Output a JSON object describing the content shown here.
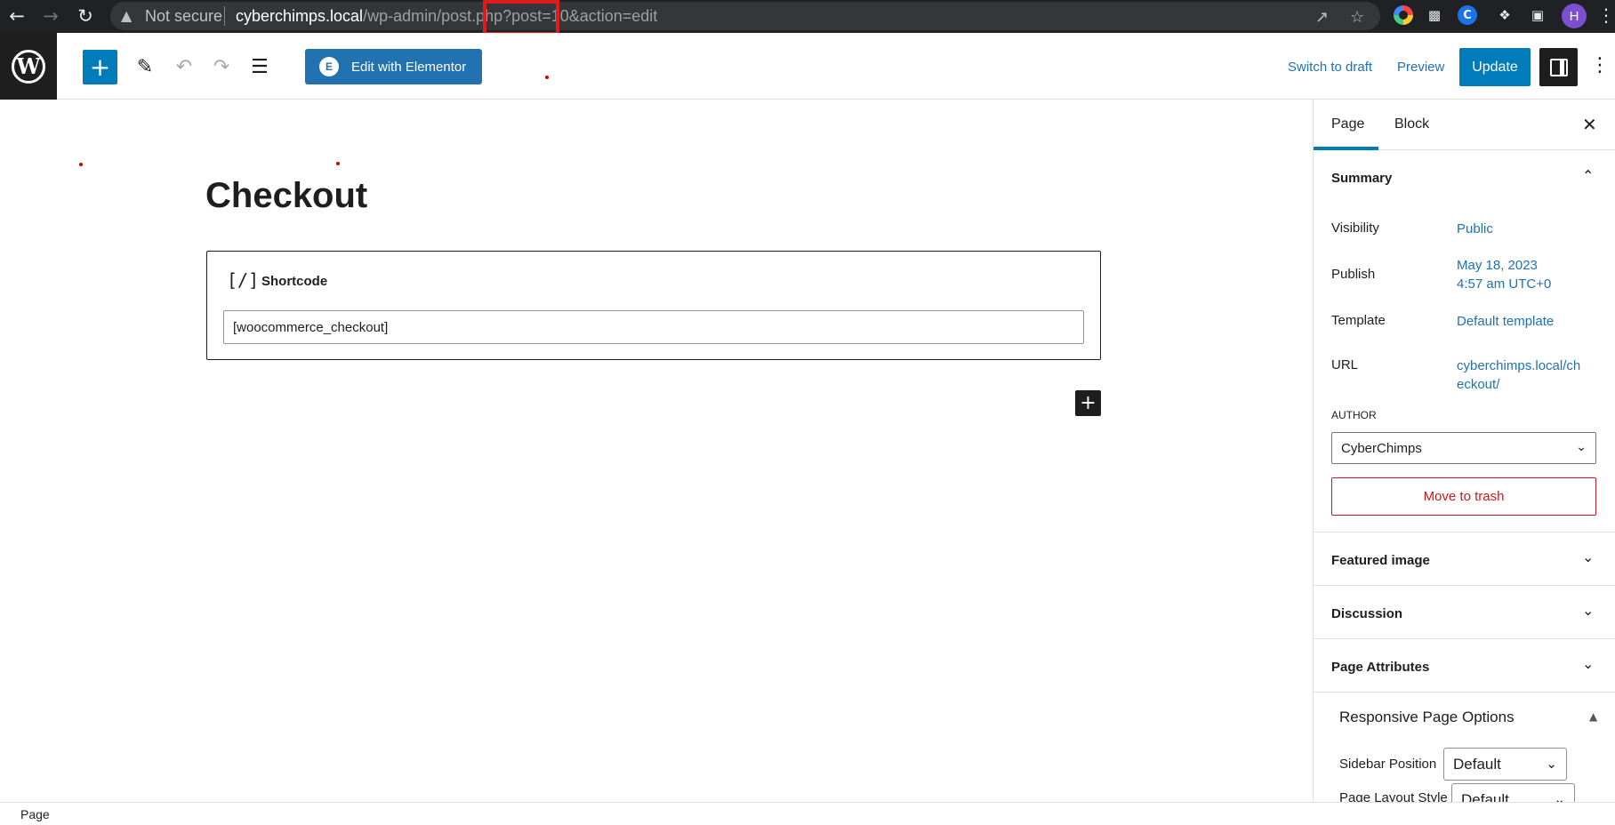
{
  "browser": {
    "security_label": "Not secure",
    "url_host": "cyberchimps.local",
    "url_path": "/wp-admin/post.php",
    "url_query": "?post=10&action=edit",
    "avatar_letter": "H"
  },
  "toolbar": {
    "elementor_label": "Edit with Elementor",
    "switch_to_draft_label": "Switch to draft",
    "preview_label": "Preview",
    "update_label": "Update"
  },
  "editor": {
    "title": "Checkout",
    "block": {
      "icon_text": "[/]",
      "label": "Shortcode",
      "value": "[woocommerce_checkout]"
    }
  },
  "sidebar": {
    "tabs": [
      {
        "label": "Page",
        "active": true
      },
      {
        "label": "Block",
        "active": false
      }
    ],
    "summary": {
      "title": "Summary",
      "rows": [
        {
          "label": "Visibility",
          "value": "Public"
        },
        {
          "label": "Publish",
          "value_line1": "May 18, 2023",
          "value_line2": "4:57 am UTC+0"
        },
        {
          "label": "Template",
          "value": "Default template"
        },
        {
          "label": "URL",
          "value_line1": "cyberchimps.local/ch",
          "value_line2": "eckout/"
        }
      ],
      "author_label": "AUTHOR",
      "author_value": "CyberChimps",
      "trash_label": "Move to trash"
    },
    "sections": [
      {
        "title": "Featured image"
      },
      {
        "title": "Discussion"
      },
      {
        "title": "Page Attributes"
      }
    ],
    "responsive": {
      "title": "Responsive Page Options",
      "sidebar_position_label": "Sidebar Position",
      "sidebar_position_value": "Default",
      "page_layout_label": "Page Layout Style",
      "page_layout_value": "Default"
    }
  },
  "footer": {
    "breadcrumb": "Page"
  },
  "colors": {
    "wp_blue": "#007cba",
    "link_blue": "#2271b1",
    "danger": "#cc1818",
    "dark": "#1e1e1e",
    "highlight_box": "#e01b1b"
  }
}
